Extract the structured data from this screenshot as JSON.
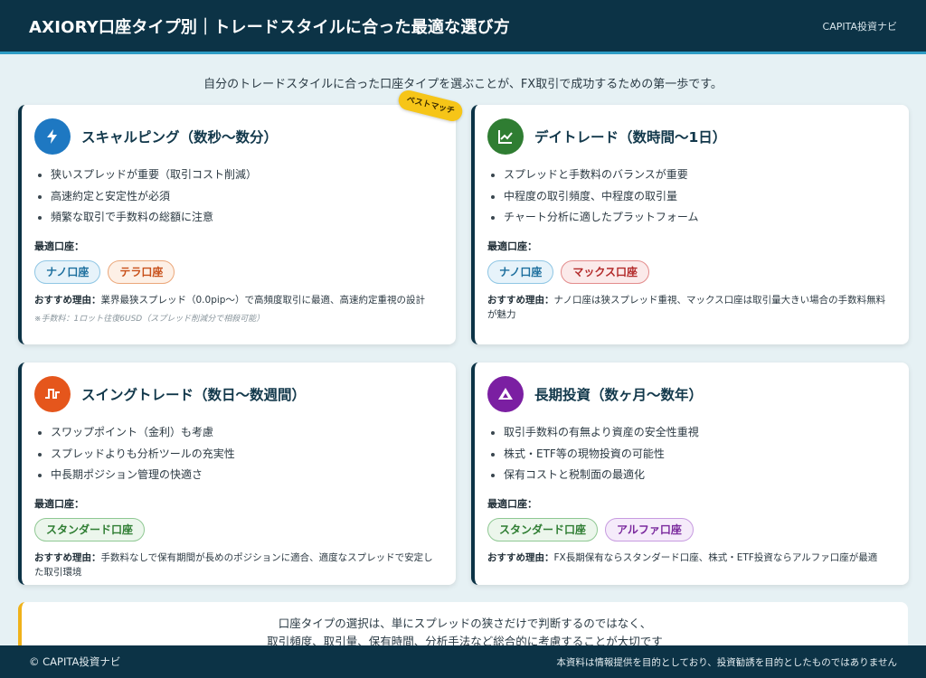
{
  "header": {
    "title": "AXIORY口座タイプ別｜トレードスタイルに合った最適な選び方",
    "brand": "CAPITA投資ナビ"
  },
  "intro": "自分のトレードスタイルに合った口座タイプを選ぶことが、FX取引で成功するための第一歩です。",
  "badge": "ベストマッチ",
  "cards": [
    {
      "title": "スキャルピング（数秒〜数分）",
      "icon": "lightning-icon",
      "color": "#1e78c2",
      "bullets": [
        "狭いスプレッドが重要（取引コスト削減）",
        "高速約定と安定性が必須",
        "頻繁な取引で手数料の総額に注意"
      ],
      "best_label": "最適口座：",
      "tags": [
        "ナノ口座",
        "テラ口座"
      ],
      "reason_label": "おすすめ理由：",
      "reason": "業界最狭スプレッド（0.0pip〜）で高頻度取引に最適、高速約定重視の設計",
      "note": "※手数料：1ロット往復6USD（スプレッド削減分で相殺可能）"
    },
    {
      "title": "デイトレード（数時間〜1日）",
      "icon": "chart-line-icon",
      "color": "#2f7d32",
      "bullets": [
        "スプレッドと手数料のバランスが重要",
        "中程度の取引頻度、中程度の取引量",
        "チャート分析に適したプラットフォーム"
      ],
      "best_label": "最適口座：",
      "tags": [
        "ナノ口座",
        "マックス口座"
      ],
      "reason_label": "おすすめ理由：",
      "reason": "ナノ口座は狭スプレッド重視、マックス口座は取引量大きい場合の手数料無料が魅力"
    },
    {
      "title": "スイングトレード（数日〜数週間）",
      "icon": "wave-icon",
      "color": "#e5561c",
      "bullets": [
        "スワップポイント（金利）も考慮",
        "スプレッドよりも分析ツールの充実性",
        "中長期ポジション管理の快適さ"
      ],
      "best_label": "最適口座：",
      "tags": [
        "スタンダード口座"
      ],
      "reason_label": "おすすめ理由：",
      "reason": "手数料なしで保有期間が長めのポジションに適合、適度なスプレッドで安定した取引環境"
    },
    {
      "title": "長期投資（数ヶ月〜数年）",
      "icon": "mountain-icon",
      "color": "#7b1fa2",
      "bullets": [
        "取引手数料の有無より資産の安全性重視",
        "株式・ETF等の現物投資の可能性",
        "保有コストと税制面の最適化"
      ],
      "best_label": "最適口座：",
      "tags": [
        "スタンダード口座",
        "アルファ口座"
      ],
      "reason_label": "おすすめ理由：",
      "reason": "FX長期保有ならスタンダード口座、株式・ETF投資ならアルファ口座が最適"
    }
  ],
  "summary": {
    "line1": "口座タイプの選択は、単にスプレッドの狭さだけで判断するのではなく、",
    "line2": "取引頻度、取引量、保有時間、分析手法など総合的に考慮することが大切です"
  },
  "footer": {
    "copyright": "© CAPITA投資ナビ",
    "disclaimer": "本資料は情報提供を目的としており、投資勧誘を目的としたものではありません"
  }
}
